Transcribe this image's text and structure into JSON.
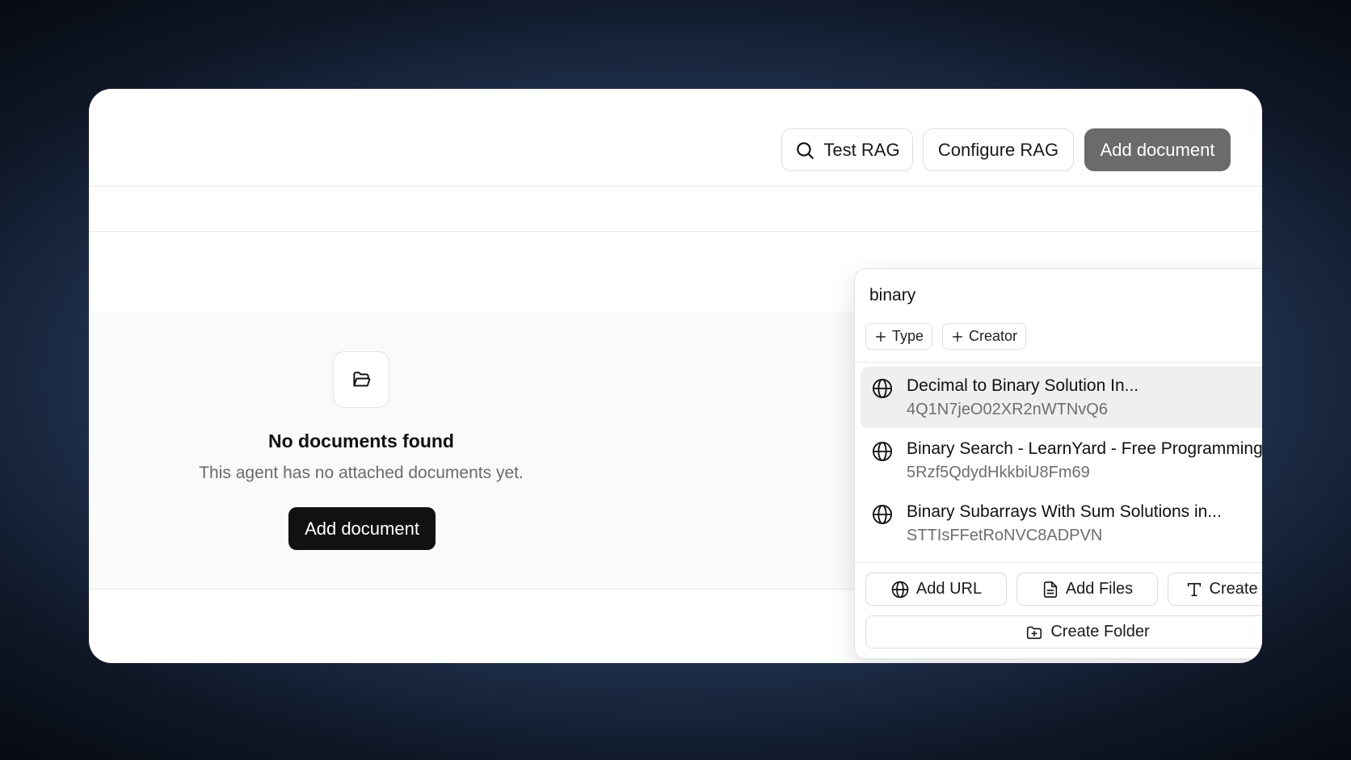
{
  "toolbar": {
    "test_rag": "Test RAG",
    "configure_rag": "Configure RAG",
    "add_document": "Add document"
  },
  "empty_state": {
    "title": "No documents found",
    "subtitle": "This agent has no attached documents yet.",
    "add_button": "Add document",
    "icon": "folder-open-icon"
  },
  "picker": {
    "search_value": "binary",
    "filters": [
      {
        "label": "Type",
        "icon": "plus-icon"
      },
      {
        "label": "Creator",
        "icon": "plus-icon"
      }
    ],
    "results": [
      {
        "title": "Decimal to Binary Solution In...",
        "id": "4Q1N7jeO02XR2nWTNvQ6",
        "icon": "globe-icon",
        "highlighted": true
      },
      {
        "title": "Binary Search - LearnYard - Free Programming ...",
        "id": "5Rzf5QdydHkkbiU8Fm69",
        "icon": "globe-icon",
        "highlighted": false
      },
      {
        "title": "Binary Subarrays With Sum Solutions in...",
        "id": "STTIsFFetRoNVC8ADPVN",
        "icon": "globe-icon",
        "highlighted": false
      }
    ],
    "actions": {
      "add_url": "Add URL",
      "add_files": "Add Files",
      "create_text": "Create Text",
      "create_folder": "Create Folder"
    }
  }
}
